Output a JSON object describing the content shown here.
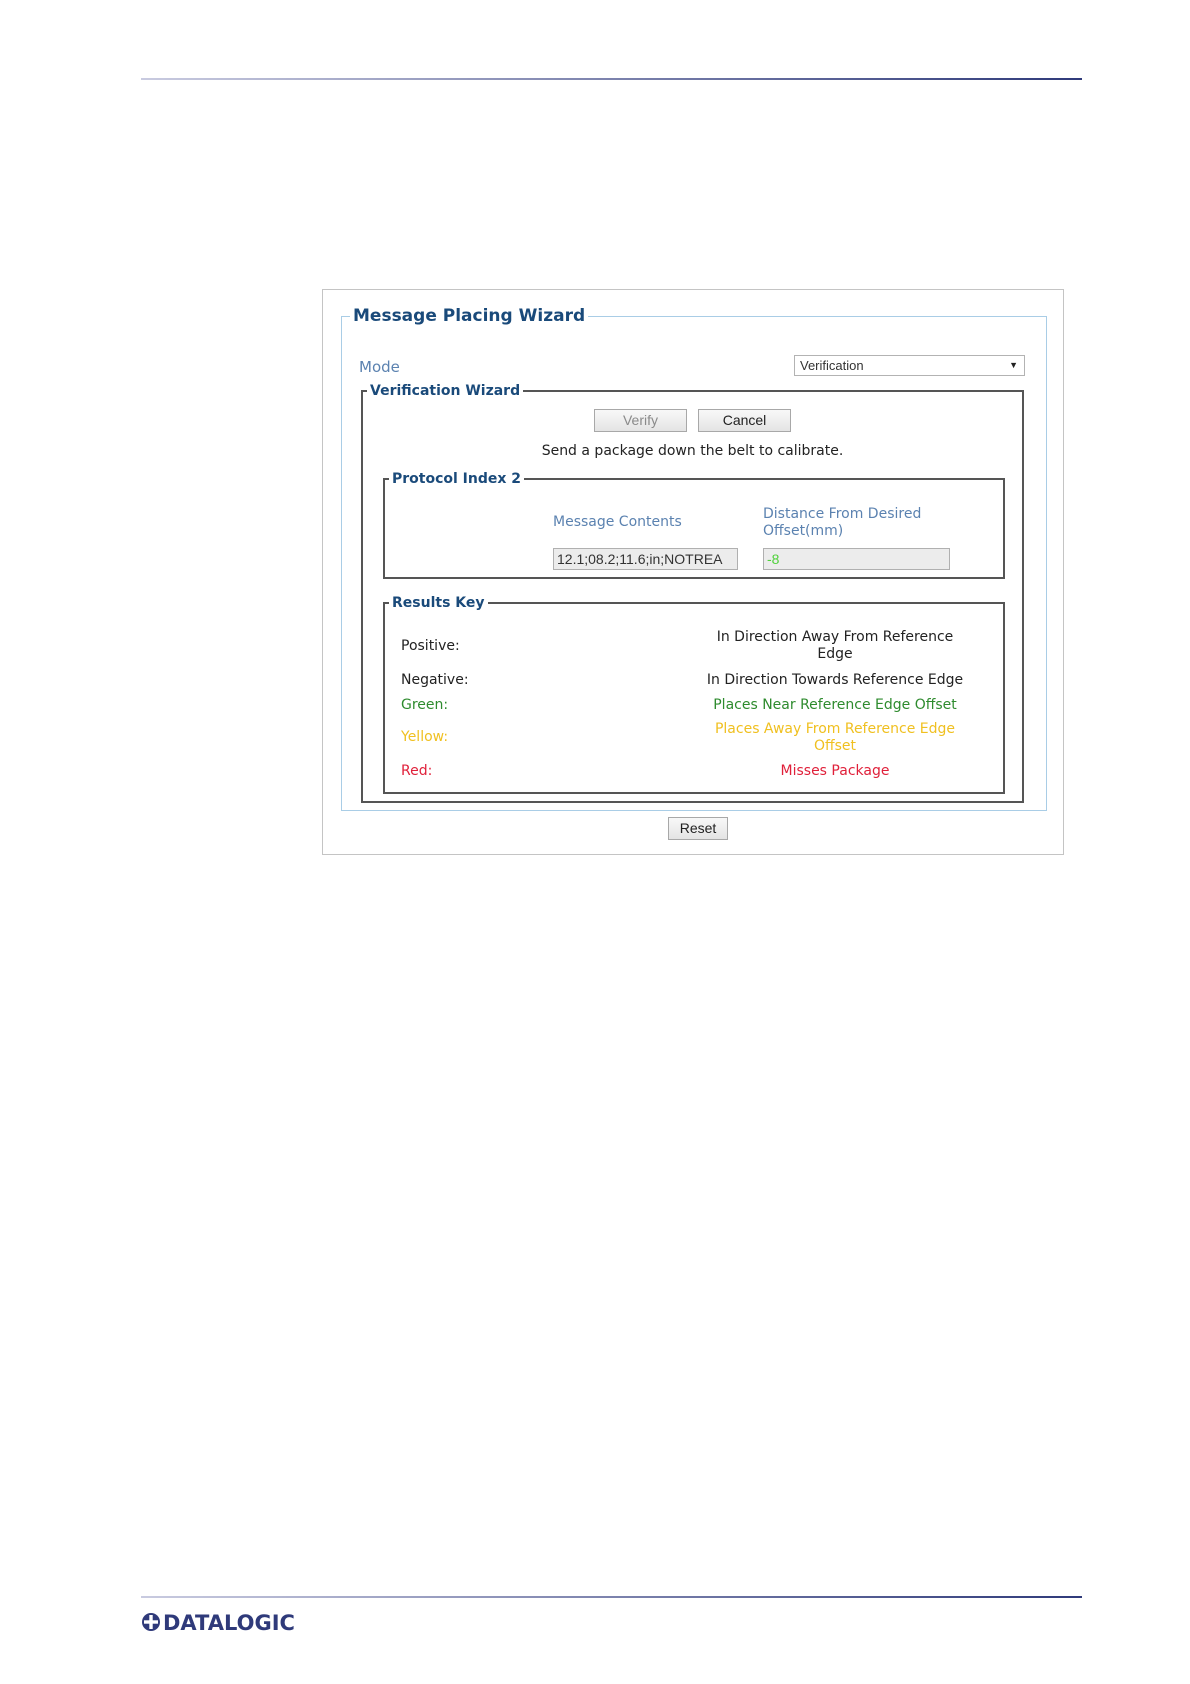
{
  "wizard": {
    "title": "Message Placing Wizard",
    "mode_label": "Mode",
    "mode_value": "Verification",
    "verification": {
      "title": "Verification Wizard",
      "verify_label": "Verify",
      "cancel_label": "Cancel",
      "instruction": "Send a package down the belt to calibrate.",
      "protocol": {
        "title": "Protocol Index 2",
        "message_contents_label": "Message Contents",
        "distance_label": "Distance From Desired Offset(mm)",
        "message_contents_value": "12.1;08.2;11.6;in;NOTREA",
        "distance_value": "-8",
        "distance_value_color": "#4fd13a"
      },
      "results_key": {
        "title": "Results Key",
        "rows": [
          {
            "label": "Positive:",
            "description": "In Direction Away From Reference Edge",
            "color": "#222222"
          },
          {
            "label": "Negative:",
            "description": "In Direction Towards Reference Edge",
            "color": "#222222"
          },
          {
            "label": "Green:",
            "description": "Places Near Reference Edge Offset",
            "color": "#2e8b2e"
          },
          {
            "label": "Yellow:",
            "description": "Places Away From Reference Edge Offset",
            "color": "#f0c020"
          },
          {
            "label": "Red:",
            "description": "Misses Package",
            "color": "#e0203a"
          }
        ]
      }
    },
    "reset_label": "Reset"
  },
  "footer": {
    "logo_text": "DATALOGIC",
    "logo_color": "#2f3a7a"
  }
}
